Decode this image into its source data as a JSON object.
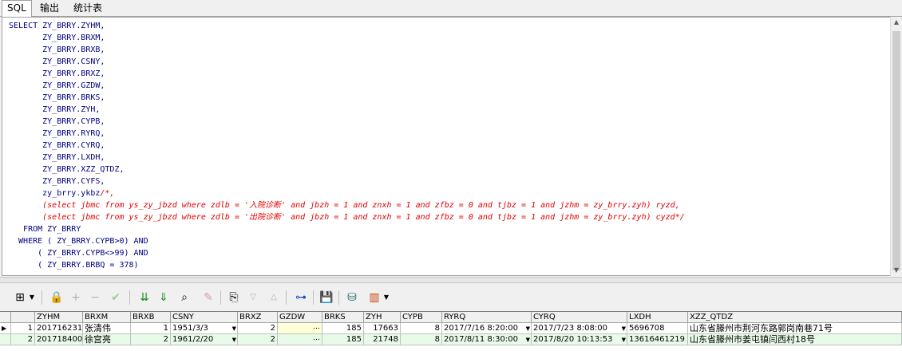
{
  "tabs": [
    {
      "label": "SQL"
    },
    {
      "label": "输出"
    },
    {
      "label": "统计表"
    }
  ],
  "code": {
    "lines": [
      "SELECT ZY_BRRY.ZYHM,",
      "       ZY_BRRY.BRXM,",
      "       ZY_BRRY.BRXB,",
      "       ZY_BRRY.CSNY,",
      "       ZY_BRRY.BRXZ,",
      "       ZY_BRRY.GZDW,",
      "       ZY_BRRY.BRKS,",
      "       ZY_BRRY.ZYH,",
      "       ZY_BRRY.CYPB,",
      "       ZY_BRRY.RYRQ,",
      "       ZY_BRRY.CYRQ,",
      "       ZY_BRRY.LXDH,",
      "       ZY_BRRY.XZZ_QTDZ,",
      "       ZY_BRRY.CYFS,",
      "       zy_brry.ykbz/*,",
      "       (select jbmc from ys_zy_jbzd where zdlb = '入院诊断' and jbzh = 1 and znxh = 1 and zfbz = 0 and tjbz = 1 and jzhm = zy_brry.zyh) ryzd,",
      "       (select jbmc from ys_zy_jbzd where zdlb = '出院诊断' and jbzh = 1 and znxh = 1 and zfbz = 0 and tjbz = 1 and jzhm = zy_brry.zyh) cyzd*/",
      "   FROM ZY_BRRY",
      "  WHERE ( ZY_BRRY.CYPB>0) AND",
      "      ( ZY_BRRY.CYPB<>99) AND",
      "      ( ZY_BRRY.BRBQ = 378)"
    ]
  },
  "grid": {
    "columns": [
      "ZYHM",
      "BRXM",
      "BRXB",
      "CSNY",
      "BRXZ",
      "GZDW",
      "BRKS",
      "ZYH",
      "CYPB",
      "RYRQ",
      "CYRQ",
      "LXDH",
      "XZZ_QTDZ"
    ],
    "rows": [
      {
        "num": "1",
        "ZYHM": "201716231",
        "BRXM": "张清伟",
        "BRXB": "1",
        "CSNY": "1951/3/3",
        "BRXZ": "2",
        "GZDW": "",
        "BRKS": "185",
        "ZYH": "17663",
        "CYPB": "8",
        "RYRQ": "2017/7/16 8:20:00",
        "CYRQ": "2017/7/23 8:08:00",
        "LXDH": "5696708",
        "XZZ_QTDZ": "山东省滕州市荆河东路郭岗南巷71号"
      },
      {
        "num": "2",
        "ZYHM": "201718400",
        "BRXM": "徐宫亮",
        "BRXB": "2",
        "CSNY": "1961/2/20",
        "BRXZ": "2",
        "GZDW": "",
        "BRKS": "185",
        "ZYH": "21748",
        "CYPB": "8",
        "RYRQ": "2017/8/11 8:30:00",
        "CYRQ": "2017/8/20 10:13:53",
        "LXDH": "13616461219",
        "XZZ_QTDZ": "山东省滕州市姜屯镇闫西村18号"
      }
    ]
  },
  "toolbar": {
    "icons": [
      "grid-icon",
      "lock-icon",
      "add-icon",
      "remove-icon",
      "post-icon",
      "sort-down-icon",
      "sort-down-all-icon",
      "find-icon",
      "clear-icon",
      "query-icon",
      "filter-icon",
      "up-icon",
      "tree-icon",
      "save-icon",
      "export-icon",
      "chart-icon"
    ]
  },
  "colors": {
    "keyword": "#000080",
    "comment": "#e00000",
    "row_alt": "#e8fbe8"
  }
}
